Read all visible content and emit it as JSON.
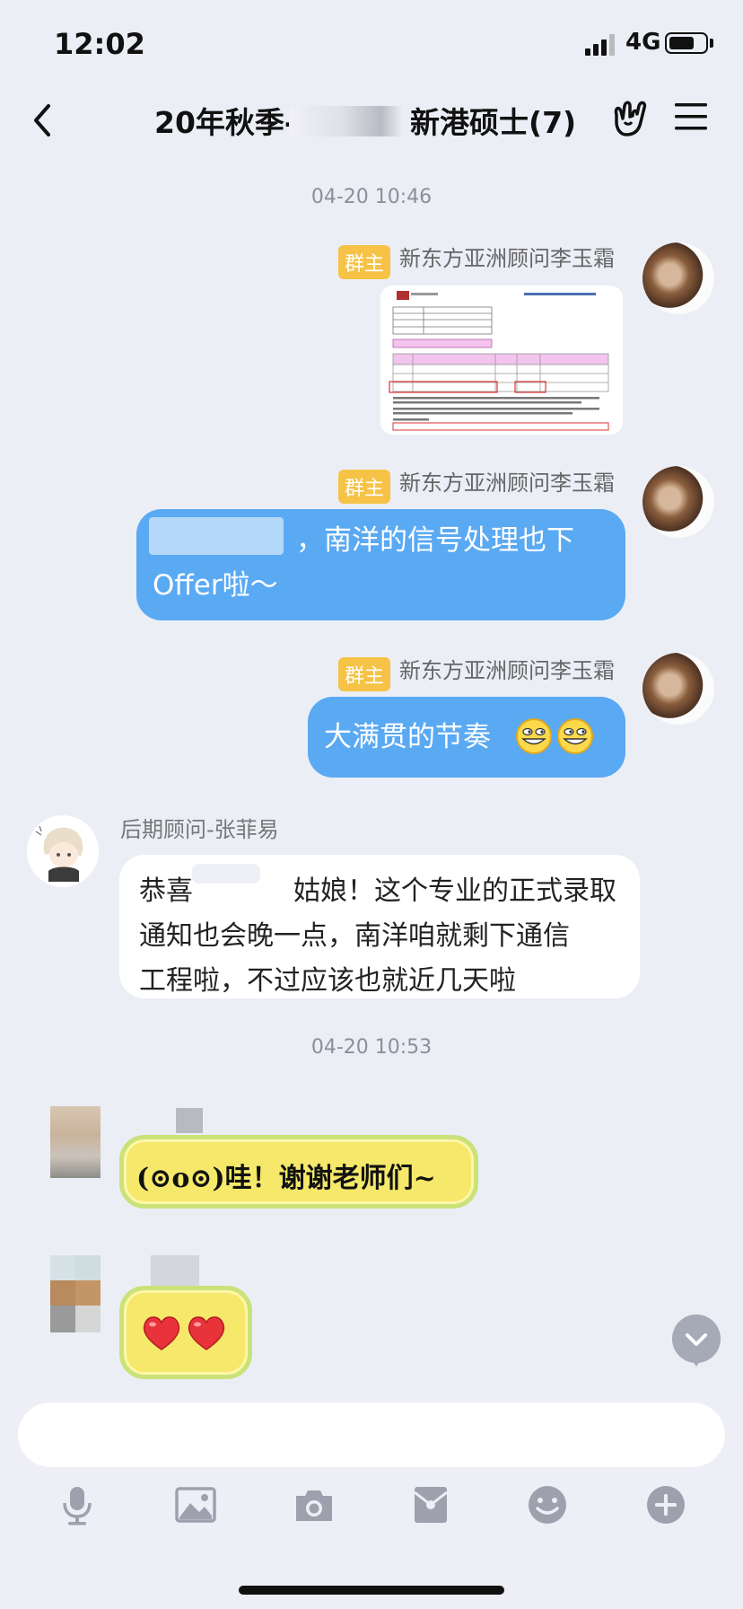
{
  "status_bar": {
    "time": "12:02",
    "network": "4G",
    "battery_level": 0.7
  },
  "header": {
    "title_prefix": "20年秋季-",
    "title_suffix": "新港硕士(7)"
  },
  "messages": {
    "ts1": "04-20 10:46",
    "m1": {
      "badge": "群主",
      "sender": "新东方亚洲顾问李玉霜"
    },
    "m2": {
      "badge": "群主",
      "sender": "新东方亚洲顾问李玉霜",
      "line1": "，南洋的信号处理也下",
      "line2": "Offer啦～"
    },
    "m3": {
      "badge": "群主",
      "sender": "新东方亚洲顾问李玉霜",
      "text": "大满贯的节奏"
    },
    "m4": {
      "sender": "后期顾问-张菲易",
      "line1_a": "恭喜",
      "line1_b": "姑娘！这个专业的正式录取",
      "line2": "通知也会晚一点，南洋咱就剩下通信",
      "line3": "工程啦，不过应该也就近几天啦"
    },
    "ts2": "04-20 10:53",
    "m5": {
      "text": "(⊙o⊙)哇！谢谢老师们~"
    }
  },
  "icons": [
    "back-icon",
    "rock-hand-icon",
    "menu-icon",
    "scroll-down-icon",
    "mic-icon",
    "image-icon",
    "camera-icon",
    "red-packet-icon",
    "emoji-icon",
    "plus-icon"
  ],
  "colors": {
    "bubble_blue": "#5aa9f3",
    "badge_yellow": "#f6c346",
    "background": "#eceef6"
  }
}
